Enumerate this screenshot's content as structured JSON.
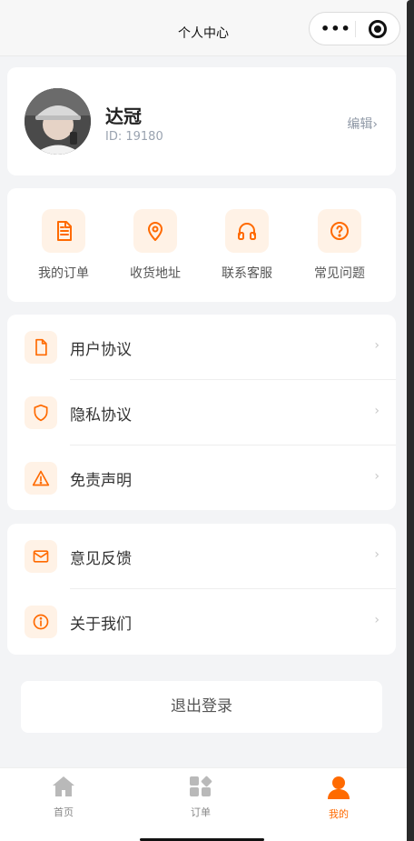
{
  "nav": {
    "title": "个人中心",
    "menu_dots": "•••"
  },
  "profile": {
    "name": "达冠",
    "id_text": "ID: 19180",
    "edit_label": "编辑›"
  },
  "quick_actions": [
    {
      "label": "我的订单",
      "icon": "document-icon"
    },
    {
      "label": "收货地址",
      "icon": "location-pin-icon"
    },
    {
      "label": "联系客服",
      "icon": "headphones-icon"
    },
    {
      "label": "常见问题",
      "icon": "question-circle-icon"
    }
  ],
  "menu_group1": [
    {
      "label": "用户协议",
      "icon": "file-icon"
    },
    {
      "label": "隐私协议",
      "icon": "shield-icon"
    },
    {
      "label": "免责声明",
      "icon": "warning-icon"
    }
  ],
  "menu_group2": [
    {
      "label": "意见反馈",
      "icon": "mail-icon"
    },
    {
      "label": "关于我们",
      "icon": "info-icon"
    }
  ],
  "chevron": "›",
  "logout_label": "退出登录",
  "tabbar": [
    {
      "label": "首页",
      "icon": "home-icon",
      "active": false
    },
    {
      "label": "订单",
      "icon": "grid-icon",
      "active": false
    },
    {
      "label": "我的",
      "icon": "user-icon",
      "active": true
    }
  ],
  "colors": {
    "accent": "#ff6a00",
    "icon_bg": "#fff2e6",
    "page_bg": "#f3f4f6"
  }
}
